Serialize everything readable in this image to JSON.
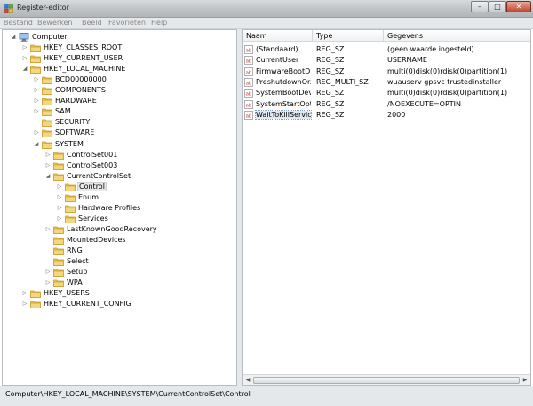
{
  "window": {
    "title": "Register-editor"
  },
  "window_buttons": {
    "minimize": "–",
    "maximize": "□",
    "close": "✕"
  },
  "menu": [
    "Bestand",
    "Bewerken",
    "Beeld",
    "Favorieten",
    "Help"
  ],
  "tree": [
    {
      "label": "Computer",
      "depth": 0,
      "expanded": true,
      "icon": "computer-icon"
    },
    {
      "label": "HKEY_CLASSES_ROOT",
      "depth": 1,
      "expanded": false,
      "icon": "folder-icon"
    },
    {
      "label": "HKEY_CURRENT_USER",
      "depth": 1,
      "expanded": false,
      "icon": "folder-icon"
    },
    {
      "label": "HKEY_LOCAL_MACHINE",
      "depth": 1,
      "expanded": true,
      "icon": "folder-icon"
    },
    {
      "label": "BCD00000000",
      "depth": 2,
      "expanded": false,
      "icon": "folder-icon"
    },
    {
      "label": "COMPONENTS",
      "depth": 2,
      "expanded": false,
      "icon": "folder-icon"
    },
    {
      "label": "HARDWARE",
      "depth": 2,
      "expanded": false,
      "icon": "folder-icon"
    },
    {
      "label": "SAM",
      "depth": 2,
      "expanded": false,
      "icon": "folder-icon"
    },
    {
      "label": "SECURITY",
      "depth": 2,
      "expanded": null,
      "icon": "folder-icon"
    },
    {
      "label": "SOFTWARE",
      "depth": 2,
      "expanded": false,
      "icon": "folder-icon"
    },
    {
      "label": "SYSTEM",
      "depth": 2,
      "expanded": true,
      "icon": "folder-icon"
    },
    {
      "label": "ControlSet001",
      "depth": 3,
      "expanded": false,
      "icon": "folder-icon"
    },
    {
      "label": "ControlSet003",
      "depth": 3,
      "expanded": false,
      "icon": "folder-icon"
    },
    {
      "label": "CurrentControlSet",
      "depth": 3,
      "expanded": true,
      "icon": "folder-icon"
    },
    {
      "label": "Control",
      "depth": 4,
      "expanded": false,
      "icon": "folder-icon",
      "selected": true
    },
    {
      "label": "Enum",
      "depth": 4,
      "expanded": false,
      "icon": "folder-icon"
    },
    {
      "label": "Hardware Profiles",
      "depth": 4,
      "expanded": false,
      "icon": "folder-icon"
    },
    {
      "label": "Services",
      "depth": 4,
      "expanded": false,
      "icon": "folder-icon"
    },
    {
      "label": "LastKnownGoodRecovery",
      "depth": 3,
      "expanded": false,
      "icon": "folder-icon"
    },
    {
      "label": "MountedDevices",
      "depth": 3,
      "expanded": null,
      "icon": "folder-icon"
    },
    {
      "label": "RNG",
      "depth": 3,
      "expanded": null,
      "icon": "folder-icon"
    },
    {
      "label": "Select",
      "depth": 3,
      "expanded": null,
      "icon": "folder-icon"
    },
    {
      "label": "Setup",
      "depth": 3,
      "expanded": false,
      "icon": "folder-icon"
    },
    {
      "label": "WPA",
      "depth": 3,
      "expanded": false,
      "icon": "folder-icon"
    },
    {
      "label": "HKEY_USERS",
      "depth": 1,
      "expanded": false,
      "icon": "folder-icon"
    },
    {
      "label": "HKEY_CURRENT_CONFIG",
      "depth": 1,
      "expanded": false,
      "icon": "folder-icon"
    }
  ],
  "columns": {
    "name": "Naam",
    "type": "Type",
    "data": "Gegevens"
  },
  "values": [
    {
      "name": "(Standaard)",
      "type": "REG_SZ",
      "data": "(geen waarde ingesteld)",
      "icon": "string-value-icon"
    },
    {
      "name": "CurrentUser",
      "type": "REG_SZ",
      "data": "USERNAME",
      "icon": "string-value-icon"
    },
    {
      "name": "FirmwareBootD...",
      "type": "REG_SZ",
      "data": "multi(0)disk(0)rdisk(0)partition(1)",
      "icon": "string-value-icon"
    },
    {
      "name": "PreshutdownOr...",
      "type": "REG_MULTI_SZ",
      "data": "wuauserv gpsvc trustedinstaller",
      "icon": "string-value-icon"
    },
    {
      "name": "SystemBootDevi...",
      "type": "REG_SZ",
      "data": "multi(0)disk(0)rdisk(0)partition(1)",
      "icon": "string-value-icon"
    },
    {
      "name": "SystemStartOpti...",
      "type": "REG_SZ",
      "data": "/NOEXECUTE=OPTIN",
      "icon": "string-value-icon"
    },
    {
      "name": "WaitToKillServic...",
      "type": "REG_SZ",
      "data": "2000",
      "icon": "string-value-icon",
      "selected": true
    }
  ],
  "status": "Computer\\HKEY_LOCAL_MACHINE\\SYSTEM\\CurrentControlSet\\Control",
  "colors": {
    "folder": "#e9c45a",
    "folder_dark": "#c99a2a",
    "value_icon": "#c0392b",
    "selection": "#dfe8f3"
  }
}
